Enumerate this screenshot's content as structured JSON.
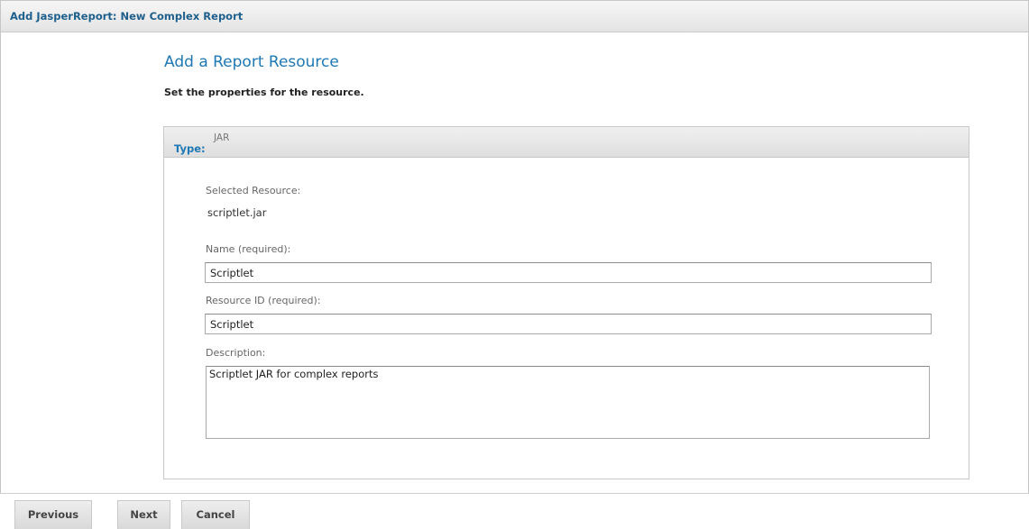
{
  "window": {
    "title": "Add JasperReport: New Complex Report"
  },
  "page": {
    "heading": "Add a Report Resource",
    "instructions": "Set the properties for the resource."
  },
  "panel": {
    "type_label": "Type:",
    "type_value": "JAR",
    "selected_resource_label": "Selected Resource:",
    "selected_resource_value": "scriptlet.jar",
    "name_label": "Name (required):",
    "name_value": "Scriptlet",
    "resource_id_label": "Resource ID (required):",
    "resource_id_value": "Scriptlet",
    "description_label": "Description:",
    "description_value": "Scriptlet JAR for complex reports"
  },
  "footer": {
    "previous_label": "Previous",
    "next_label": "Next",
    "cancel_label": "Cancel"
  },
  "colors": {
    "accent": "#1e78b4",
    "title_text": "#1f5f8b"
  }
}
